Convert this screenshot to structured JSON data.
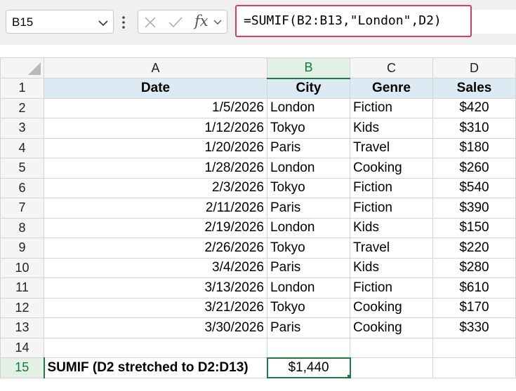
{
  "name_box": {
    "value": "B15"
  },
  "formula_bar": {
    "formula": "=SUMIF(B2:B13,\"London\",D2)",
    "fx_label": "fx"
  },
  "columns": [
    "A",
    "B",
    "C",
    "D"
  ],
  "header_row": {
    "row_num": "1",
    "cells": [
      "Date",
      "City",
      "Genre",
      "Sales"
    ]
  },
  "rows": [
    {
      "num": "2",
      "date": "1/5/2026",
      "city": "London",
      "genre": "Fiction",
      "sales": "$420"
    },
    {
      "num": "3",
      "date": "1/12/2026",
      "city": "Tokyo",
      "genre": "Kids",
      "sales": "$310"
    },
    {
      "num": "4",
      "date": "1/20/2026",
      "city": "Paris",
      "genre": "Travel",
      "sales": "$180"
    },
    {
      "num": "5",
      "date": "1/28/2026",
      "city": "London",
      "genre": "Cooking",
      "sales": "$260"
    },
    {
      "num": "6",
      "date": "2/3/2026",
      "city": "Tokyo",
      "genre": "Fiction",
      "sales": "$540"
    },
    {
      "num": "7",
      "date": "2/11/2026",
      "city": "Paris",
      "genre": "Fiction",
      "sales": "$390"
    },
    {
      "num": "8",
      "date": "2/19/2026",
      "city": "London",
      "genre": "Kids",
      "sales": "$150"
    },
    {
      "num": "9",
      "date": "2/26/2026",
      "city": "Tokyo",
      "genre": "Travel",
      "sales": "$220"
    },
    {
      "num": "10",
      "date": "3/4/2026",
      "city": "Paris",
      "genre": "Kids",
      "sales": "$280"
    },
    {
      "num": "11",
      "date": "3/13/2026",
      "city": "London",
      "genre": "Fiction",
      "sales": "$610"
    },
    {
      "num": "12",
      "date": "3/21/2026",
      "city": "Tokyo",
      "genre": "Cooking",
      "sales": "$170"
    },
    {
      "num": "13",
      "date": "3/30/2026",
      "city": "Paris",
      "genre": "Cooking",
      "sales": "$330"
    }
  ],
  "empty_row": {
    "num": "14"
  },
  "result_row": {
    "num": "15",
    "label": "SUMIF (D2 stretched to D2:D13)",
    "value": "$1,440"
  },
  "colors": {
    "accent": "#1e7a45",
    "formula_border": "#d83b63",
    "header_fill": "#dcebf3"
  },
  "icons": [
    "chevron-down-icon",
    "more-icon",
    "cancel-icon",
    "enter-icon",
    "function-icon"
  ]
}
